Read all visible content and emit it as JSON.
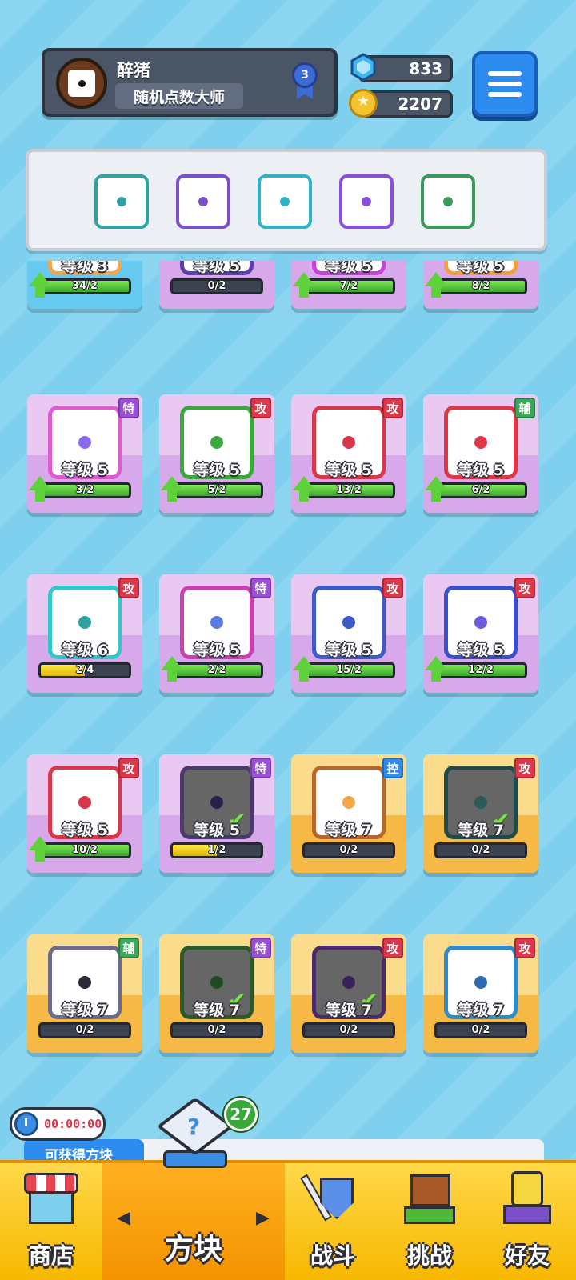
{
  "profile": {
    "name": "醉猪",
    "title": "随机点数大师",
    "rank": "3"
  },
  "currency": {
    "gems": "833",
    "coins": "2207"
  },
  "deck": {
    "slots": [
      {
        "color": "#2fa3a3"
      },
      {
        "color": "#7b4fc9"
      },
      {
        "color": "#2fb3c9"
      },
      {
        "color": "#8a4fd9"
      },
      {
        "color": "#3a9a5a"
      }
    ]
  },
  "cards": [
    {
      "bg": "blue",
      "level": "等级 3",
      "progress": "34/2",
      "fill": 1.0,
      "fillColor": "green",
      "arrow": true,
      "border": "#f3a64a",
      "pip": "#f3a64a",
      "tag": ""
    },
    {
      "bg": "purple",
      "level": "等级 5",
      "progress": "0/2",
      "fill": 0,
      "fillColor": "green",
      "arrow": false,
      "border": "#5b3fb0",
      "pip": "#5b3fb0",
      "tag": ""
    },
    {
      "bg": "purple",
      "level": "等级 5",
      "progress": "7/2",
      "fill": 1.0,
      "fillColor": "green",
      "arrow": true,
      "border": "#c93fd9",
      "pip": "#c93fd9",
      "tag": ""
    },
    {
      "bg": "purple",
      "level": "等级 5",
      "progress": "8/2",
      "fill": 1.0,
      "fillColor": "green",
      "arrow": true,
      "border": "#f3a03a",
      "pip": "#f3a03a",
      "tag": ""
    },
    {
      "bg": "purple",
      "level": "等级 5",
      "progress": "3/2",
      "fill": 1.0,
      "fillColor": "green",
      "arrow": true,
      "border": "#e05bd0",
      "pip": "#8a6bf0",
      "tag": "特",
      "tagColor": "#9b4fd9"
    },
    {
      "bg": "purple",
      "level": "等级 5",
      "progress": "5/2",
      "fill": 1.0,
      "fillColor": "green",
      "arrow": true,
      "border": "#3aa83a",
      "pip": "#3aa83a",
      "tag": "攻",
      "tagColor": "#e0364a"
    },
    {
      "bg": "purple",
      "level": "等级 5",
      "progress": "13/2",
      "fill": 1.0,
      "fillColor": "green",
      "arrow": true,
      "border": "#d9364a",
      "pip": "#d9364a",
      "tag": "攻",
      "tagColor": "#e0364a"
    },
    {
      "bg": "purple",
      "level": "等级 5",
      "progress": "6/2",
      "fill": 1.0,
      "fillColor": "green",
      "arrow": true,
      "border": "#e0364a",
      "pip": "#e0364a",
      "tag": "辅",
      "tagColor": "#3aa85a"
    },
    {
      "bg": "purple",
      "level": "等级 6",
      "progress": "2/4",
      "fill": 0.5,
      "fillColor": "yellow",
      "arrow": false,
      "border": "#2fc9c9",
      "pip": "#2fa3a3",
      "tag": "攻",
      "tagColor": "#e0364a"
    },
    {
      "bg": "purple",
      "level": "等级 5",
      "progress": "2/2",
      "fill": 1.0,
      "fillColor": "green",
      "arrow": true,
      "border": "#c93fb0",
      "pip": "#5b7be0",
      "tag": "特",
      "tagColor": "#9b4fd9"
    },
    {
      "bg": "purple",
      "level": "等级 5",
      "progress": "15/2",
      "fill": 1.0,
      "fillColor": "green",
      "arrow": true,
      "border": "#3a5bc9",
      "pip": "#3a5bc9",
      "tag": "攻",
      "tagColor": "#e0364a"
    },
    {
      "bg": "purple",
      "level": "等级 5",
      "progress": "12/2",
      "fill": 1.0,
      "fillColor": "green",
      "arrow": true,
      "border": "#3a4fc9",
      "pip": "#6b5be0",
      "tag": "攻",
      "tagColor": "#e0364a"
    },
    {
      "bg": "purple",
      "level": "等级 5",
      "progress": "10/2",
      "fill": 1.0,
      "fillColor": "green",
      "arrow": true,
      "border": "#d9364a",
      "pip": "#d9364a",
      "tag": "攻",
      "tagColor": "#e0364a"
    },
    {
      "bg": "purple",
      "level": "等级 5",
      "progress": "1/2",
      "fill": 0.5,
      "fillColor": "yellow",
      "arrow": false,
      "border": "#4a3a6b",
      "pip": "#2a1f4a",
      "tag": "特",
      "tagColor": "#9b4fd9",
      "dark": true,
      "check": true
    },
    {
      "bg": "gold",
      "level": "等级 7",
      "progress": "0/2",
      "fill": 0,
      "fillColor": "green",
      "arrow": false,
      "border": "#b8662a",
      "pip": "#f3a64a",
      "tag": "控",
      "tagColor": "#2d8cf0"
    },
    {
      "bg": "gold",
      "level": "等级 7",
      "progress": "0/2",
      "fill": 0,
      "fillColor": "green",
      "arrow": false,
      "border": "#1f4a4a",
      "pip": "#2a5a5a",
      "tag": "攻",
      "tagColor": "#e0364a",
      "dark": true,
      "check": true
    },
    {
      "bg": "gold",
      "level": "等级 7",
      "progress": "0/2",
      "fill": 0,
      "fillColor": "green",
      "arrow": false,
      "border": "#6b6b8a",
      "pip": "#2a2a3a",
      "tag": "辅",
      "tagColor": "#3aa85a"
    },
    {
      "bg": "gold",
      "level": "等级 7",
      "progress": "0/2",
      "fill": 0,
      "fillColor": "green",
      "arrow": false,
      "border": "#2a5a2a",
      "pip": "#1f4a1f",
      "tag": "特",
      "tagColor": "#9b4fd9",
      "dark": true,
      "check": true
    },
    {
      "bg": "gold",
      "level": "等级 7",
      "progress": "0/2",
      "fill": 0,
      "fillColor": "green",
      "arrow": false,
      "border": "#4a2a6b",
      "pip": "#3a1f5a",
      "tag": "攻",
      "tagColor": "#e0364a",
      "dark": true,
      "check": true
    },
    {
      "bg": "gold",
      "level": "等级 7",
      "progress": "0/2",
      "fill": 0,
      "fillColor": "green",
      "arrow": false,
      "border": "#2f8ac9",
      "pip": "#2f6ab0",
      "tag": "攻",
      "tagColor": "#e0364a"
    }
  ],
  "timer": "00:00:00",
  "notice": "可获得方块",
  "cube_count": "27",
  "nav": {
    "shop": "商店",
    "cubes": "方块",
    "battle": "战斗",
    "challenge": "挑战",
    "friends": "好友"
  },
  "icons": {
    "gem": "gem-icon",
    "coin": "coin-icon",
    "menu": "menu-icon",
    "check": "✔"
  }
}
